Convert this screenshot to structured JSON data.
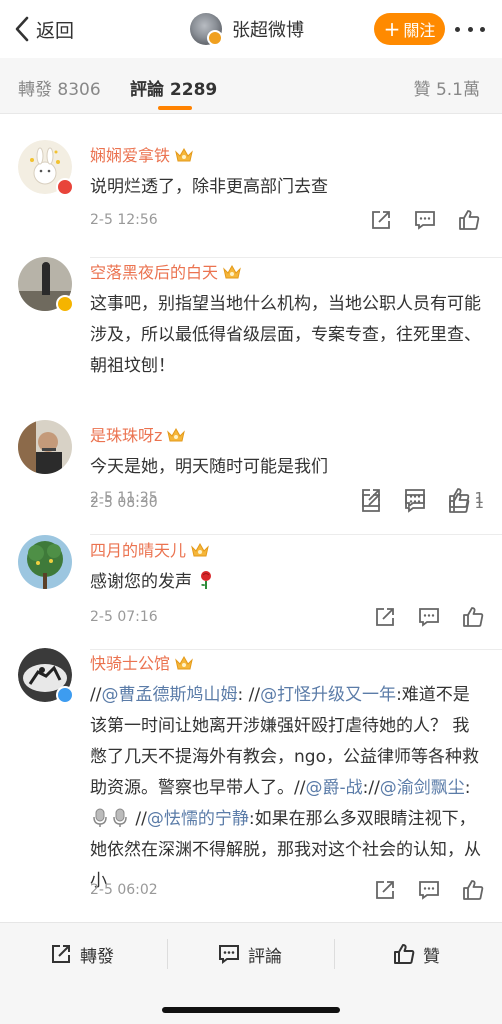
{
  "header": {
    "back_label": "返回",
    "author_name": "张超微博",
    "follow_label": "關注",
    "follow_plus": "+"
  },
  "tabs": {
    "repost": "轉發 8306",
    "comment": "評論 2289",
    "like": "贊 5.1萬"
  },
  "comments": [
    {
      "name": "娴娴爱拿铁",
      "text": "说明烂透了，除非更高部门去查",
      "time": "2-5 12:56",
      "likes": ""
    },
    {
      "name": "空落黑夜后的白天",
      "text": "这事吧，别指望当地什么机构，当地公职人员有可能涉及，所以最低得省级层面，专案专查，往死里查、朝祖坟刨！",
      "time": "2-5 11:25",
      "likes": "1"
    },
    {
      "name": "是珠珠呀z",
      "text": "今天是她，明天随时可能是我们",
      "time": "2-5 08:30",
      "likes": "1"
    },
    {
      "name": "四月的晴天儿",
      "text": "感谢您的发声",
      "time": "2-5 07:16",
      "likes": ""
    },
    {
      "name": "快骑士公馆",
      "parts": {
        "p1": "//",
        "m1": "@曹孟德斯鸠山姆",
        "p2": ": //",
        "m2": "@打怪升级又一年",
        "p3": ":难道不是该第一时间让她离开涉嫌强奸殴打虐待她的人？ 我憋了几天不提海外有教会，ngo，公益律师等各种救助资源。警察也早带人了。//",
        "m3": "@爵-战",
        "p4": "://",
        "m4": "@渝剑飘尘",
        "p5": ":",
        "p6": " //",
        "m5": "@怯懦的宁静",
        "p7": ":如果在那么多双眼睛注视下，她依然在深渊不得解脱，那我对这个社会的认知，从小"
      },
      "time": "2-5 06:02",
      "likes": ""
    }
  ],
  "bottom": {
    "repost": "轉發",
    "comment": "評論",
    "like": "贊"
  },
  "colors": {
    "accent": "#ff8200",
    "username": "#eb7350",
    "link": "#5b7ca8"
  },
  "icons": {
    "back": "chevron-left-icon",
    "share": "share-icon",
    "comment": "comment-icon",
    "like": "thumbs-up-icon",
    "crown": "crown-badge-icon",
    "rose": "rose-emoji-icon",
    "mic": "microphone-emoji-icon"
  }
}
